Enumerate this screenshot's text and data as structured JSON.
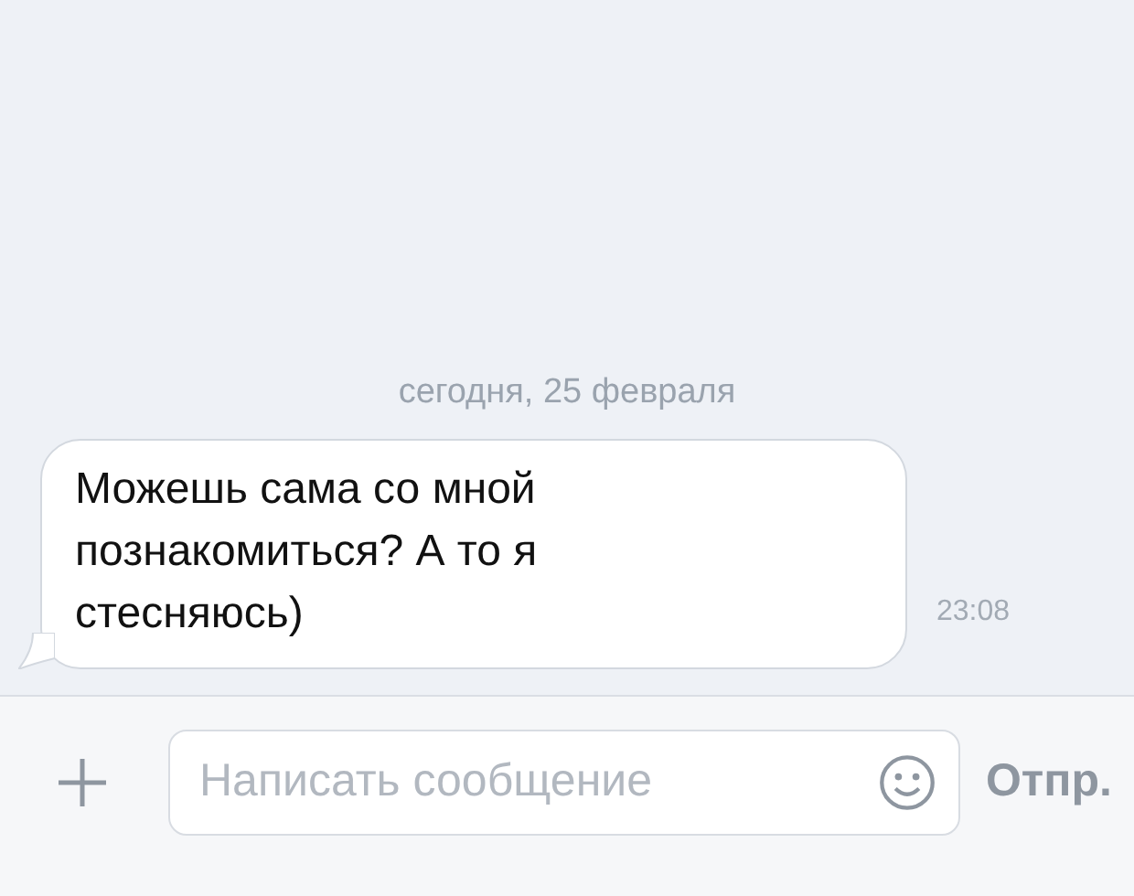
{
  "date_divider": "сегодня, 25 февраля",
  "messages": [
    {
      "text": "Можешь сама со мной познакомиться? А то я стесняюсь)",
      "time": "23:08"
    }
  ],
  "composer": {
    "placeholder": "Написать сообщение",
    "send": "Отпр."
  }
}
